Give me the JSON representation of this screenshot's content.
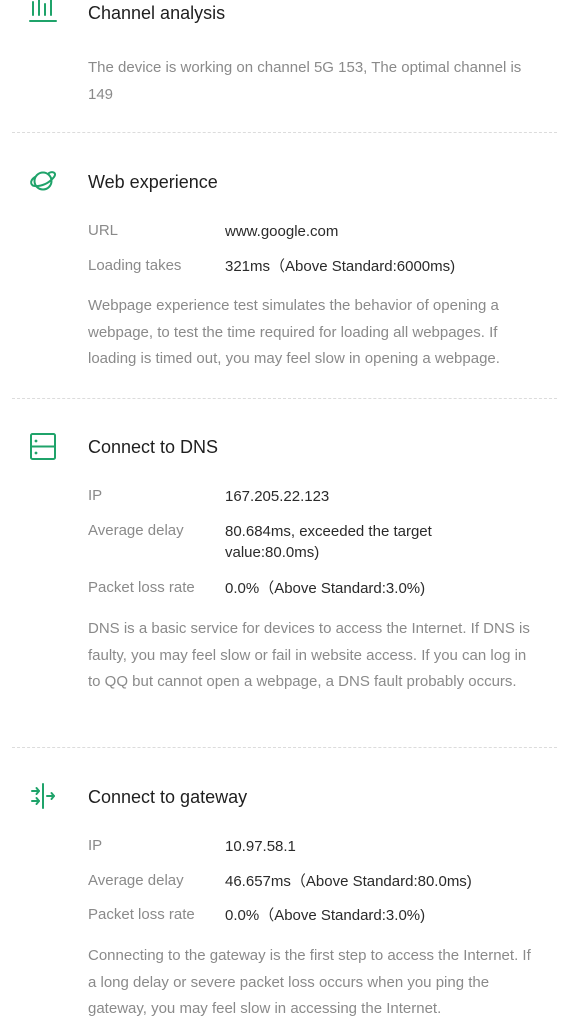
{
  "channel": {
    "title": "Channel analysis",
    "icon": "bar-chart-icon",
    "description": "The device is working on channel 5G 153, The optimal channel is 149"
  },
  "web": {
    "title": "Web experience",
    "icon": "planet-icon",
    "url_label": "URL",
    "url_value": "www.google.com",
    "loading_label": "Loading takes",
    "loading_value": "321ms（Above Standard:6000ms)",
    "description": "Webpage experience test simulates the behavior of opening a webpage, to test the time required for loading all webpages. If loading is timed out, you may feel slow in opening a webpage."
  },
  "dns": {
    "title": "Connect to DNS",
    "icon": "server-icon",
    "ip_label": "IP",
    "ip_value": "167.205.22.123",
    "delay_label": "Average delay",
    "delay_value": "80.684ms, exceeded the target value:80.0ms)",
    "loss_label": "Packet loss rate",
    "loss_value": "0.0%（Above Standard:3.0%)",
    "description": "DNS is a basic service for devices to access the Internet. If DNS is faulty, you may feel slow or fail in website access. If you can log in to QQ but cannot open a webpage, a DNS fault probably occurs."
  },
  "gateway": {
    "title": "Connect to gateway",
    "icon": "gateway-arrows-icon",
    "ip_label": "IP",
    "ip_value": "10.97.58.1",
    "delay_label": "Average delay",
    "delay_value": "46.657ms（Above Standard:80.0ms)",
    "loss_label": "Packet loss rate",
    "loss_value": "0.0%（Above Standard:3.0%)",
    "description": "Connecting to the gateway is the first step to access the Internet. If a long delay or severe packet loss occurs when you ping the gateway, you may feel slow in accessing the Internet."
  },
  "colors": {
    "accent": "#1fa36a",
    "text_primary": "#1f1f1f",
    "text_secondary": "#8a8a8a"
  }
}
